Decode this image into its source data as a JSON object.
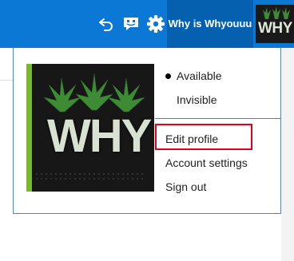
{
  "header": {
    "account_name": "Why is Whyouuu",
    "avatar_text": "WHY",
    "icons": [
      "undo-icon",
      "feedback-icon",
      "gear-icon"
    ]
  },
  "profile": {
    "picture_text": "WHY"
  },
  "menu": {
    "status_options": [
      {
        "label": "Available",
        "selected": true
      },
      {
        "label": "Invisible",
        "selected": false
      }
    ],
    "actions": [
      {
        "label": "Edit profile",
        "highlighted": true
      },
      {
        "label": "Account settings",
        "highlighted": false
      },
      {
        "label": "Sign out",
        "highlighted": false
      }
    ]
  },
  "colors": {
    "topbar": "#0a78d4",
    "account_button": "#0560b0",
    "panel_border": "#2f8fe0",
    "highlight": "#e3001b",
    "accent_green": "#7cb82f"
  }
}
